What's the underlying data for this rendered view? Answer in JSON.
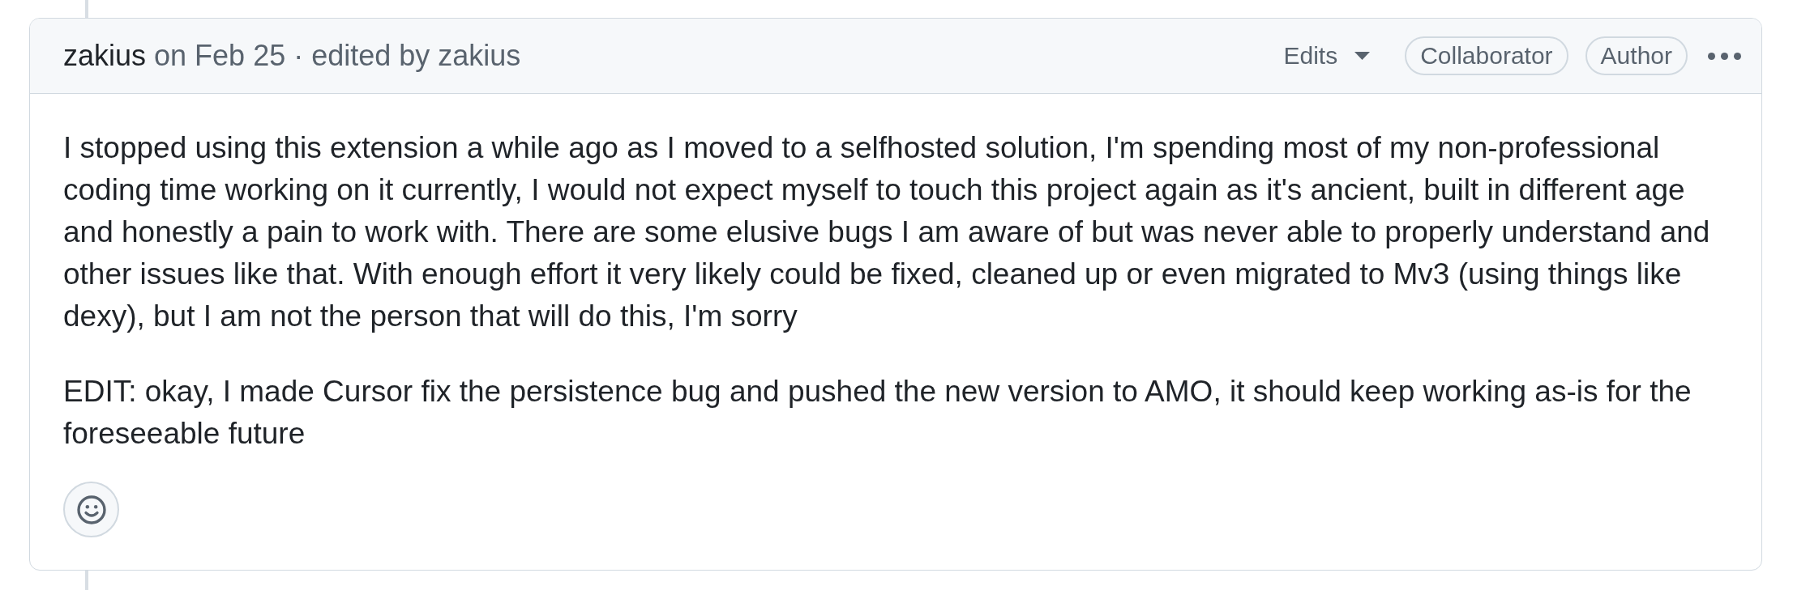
{
  "comment": {
    "header": {
      "author": "zakius",
      "timestamp": "on Feb 25",
      "separator": "·",
      "edit_note": "edited by zakius",
      "edits_menu": {
        "label": "Edits"
      },
      "badges": [
        "Collaborator",
        "Author"
      ]
    },
    "body": {
      "paragraphs": [
        "I stopped using this extension a while ago as I moved to a selfhosted solution, I'm spending most of my non-professional coding time working on it currently, I would not expect myself to touch this project again as it's ancient, built in different age and honestly a pain to work with. There are some elusive bugs I am aware of but was never able to properly understand and other issues like that. With enough effort it very likely could be fixed, cleaned up or even migrated to Mv3 (using things like dexy), but I am not the person that will do this, I'm sorry",
        "EDIT: okay, I made Cursor fix the persistence bug and pushed the new version to AMO, it should keep working as-is for the foreseeable future"
      ]
    }
  }
}
